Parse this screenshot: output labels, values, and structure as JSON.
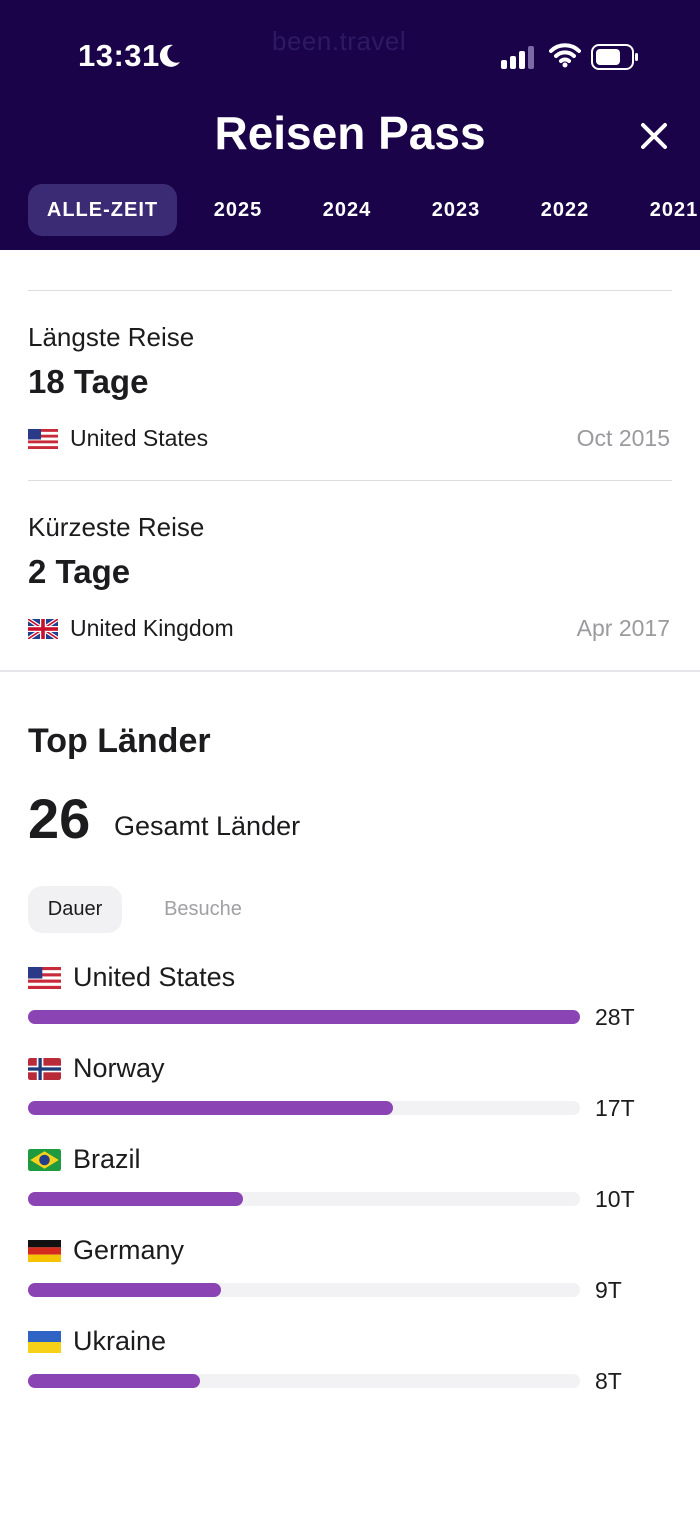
{
  "status_bar": {
    "time": "13:31",
    "watermark": "been.travel"
  },
  "header": {
    "title": "Reisen Pass",
    "tabs": [
      {
        "label": "ALLE-ZEIT",
        "active": true
      },
      {
        "label": "2025"
      },
      {
        "label": "2024"
      },
      {
        "label": "2023"
      },
      {
        "label": "2022"
      },
      {
        "label": "2021"
      }
    ]
  },
  "longest_trip": {
    "label": "Längste Reise",
    "value": "18 Tage",
    "country": "United States",
    "flag": "us-flag-icon",
    "date": "Oct 2015"
  },
  "shortest_trip": {
    "label": "Kürzeste Reise",
    "value": "2 Tage",
    "country": "United Kingdom",
    "flag": "uk-flag-icon",
    "date": "Apr 2017"
  },
  "top_countries": {
    "title": "Top Länder",
    "total": "26",
    "total_label": "Gesamt Länder",
    "toggle": {
      "active": "Dauer",
      "inactive": "Besuche"
    },
    "rows": [
      {
        "name": "United States",
        "value": "28T",
        "days": 28,
        "flag": "us-flag-icon"
      },
      {
        "name": "Norway",
        "value": "17T",
        "days": 17,
        "flag": "norway-flag-icon"
      },
      {
        "name": "Brazil",
        "value": "10T",
        "days": 10,
        "flag": "brazil-flag-icon"
      },
      {
        "name": "Germany",
        "value": "9T",
        "days": 9,
        "flag": "germany-flag-icon"
      },
      {
        "name": "Ukraine",
        "value": "8T",
        "days": 8,
        "flag": "ukraine-flag-icon"
      }
    ],
    "max_days": 28
  },
  "colors": {
    "header_bg": "#1a0348",
    "active_tab": "#3b2a74",
    "bar_fill": "#8a44b4",
    "bar_track": "#f2f2f4"
  }
}
